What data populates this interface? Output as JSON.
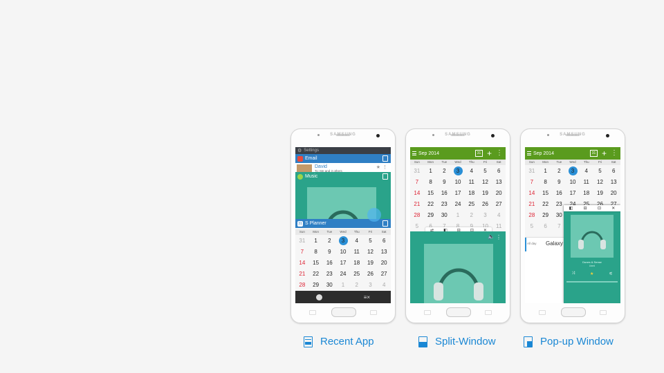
{
  "brand": "SAMSUNG",
  "calendar": {
    "month_label": "Sep 2014",
    "weekdays": [
      "Sun",
      "Mon",
      "Tue",
      "Wed",
      "Thu",
      "Fri",
      "Sat"
    ],
    "weeks": [
      [
        "31",
        "1",
        "2",
        "3",
        "4",
        "5",
        "6"
      ],
      [
        "7",
        "8",
        "9",
        "10",
        "11",
        "12",
        "13"
      ],
      [
        "14",
        "15",
        "16",
        "17",
        "18",
        "19",
        "20"
      ],
      [
        "21",
        "22",
        "23",
        "24",
        "25",
        "26",
        "27"
      ],
      [
        "28",
        "29",
        "30",
        "1",
        "2",
        "3",
        "4"
      ],
      [
        "5",
        "6",
        "7",
        "8",
        "9",
        "10",
        "11"
      ]
    ],
    "today": "3"
  },
  "phone1": {
    "settings_label": "Settings",
    "email_label": "Email",
    "email_sender": "David",
    "email_snippet": "To: Me and 3 others",
    "music_label": "Music",
    "planner_label": "S Planner"
  },
  "phone3": {
    "all_day_label": "All day",
    "event_label": "Galaxy",
    "song_title": "Dunes & Sense",
    "song_artist": "Used"
  },
  "captions": {
    "recent_app": "Recent App",
    "split_window": "Split-Window",
    "popup_window": "Pop-up Window"
  },
  "colors": {
    "accent_blue": "#1a87d4",
    "planner_green": "#5a9b1e",
    "music_teal": "#2aa38a",
    "today_blue": "#2a8fd6"
  }
}
